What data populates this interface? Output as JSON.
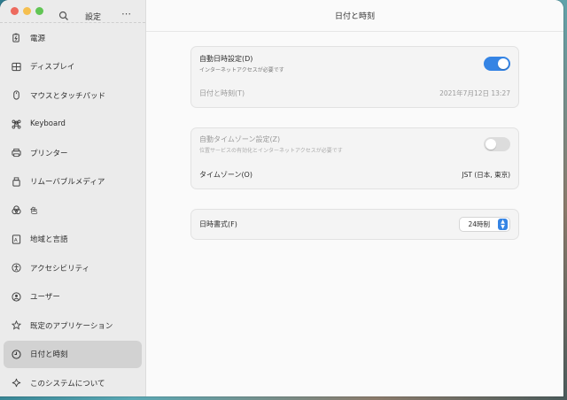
{
  "sidebar": {
    "title": "設定",
    "menu_glyph": "⋯",
    "items": [
      {
        "label": "電源",
        "icon": "power-icon"
      },
      {
        "label": "ディスプレイ",
        "icon": "display-icon"
      },
      {
        "label": "マウスとタッチパッド",
        "icon": "mouse-icon"
      },
      {
        "label": "Keyboard",
        "icon": "keyboard-icon"
      },
      {
        "label": "プリンター",
        "icon": "printer-icon"
      },
      {
        "label": "リムーバブルメディア",
        "icon": "removable-media-icon"
      },
      {
        "label": "色",
        "icon": "color-icon"
      },
      {
        "label": "地域と言語",
        "icon": "region-language-icon"
      },
      {
        "label": "アクセシビリティ",
        "icon": "accessibility-icon"
      },
      {
        "label": "ユーザー",
        "icon": "user-icon"
      },
      {
        "label": "既定のアプリケーション",
        "icon": "star-icon"
      },
      {
        "label": "日付と時刻",
        "icon": "clock-icon"
      },
      {
        "label": "このシステムについて",
        "icon": "sparkle-icon"
      }
    ]
  },
  "main": {
    "title": "日付と時刻",
    "auto_datetime": {
      "label": "自動日時設定(D)",
      "sublabel": "インターネットアクセスが必要です",
      "enabled": true
    },
    "datetime": {
      "label": "日付と時刻(T)",
      "value": "2021年7月12日 13:27"
    },
    "auto_timezone": {
      "label": "自動タイムゾーン設定(Z)",
      "sublabel": "位置サービスの有効化とインターネットアクセスが必要です",
      "enabled": false
    },
    "timezone": {
      "label": "タイムゾーン(O)",
      "value": "JST (日本, 東京)"
    },
    "time_format": {
      "label": "日時書式(F)",
      "value": "24時制"
    }
  },
  "colors": {
    "accent": "#3584e4"
  }
}
